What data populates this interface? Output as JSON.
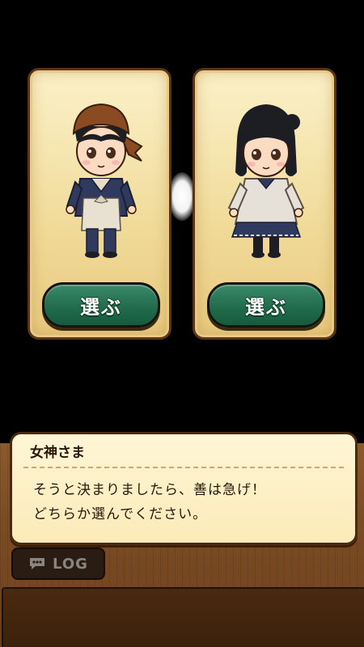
{
  "characters": [
    {
      "button_label": "選ぶ",
      "icon": "male-waiter-character"
    },
    {
      "button_label": "選ぶ",
      "icon": "female-waitress-character"
    }
  ],
  "dialog": {
    "speaker": "女神さま",
    "lines": [
      "そうと決まりましたら、善は急げ！",
      "どちらか選んでください。"
    ]
  },
  "log_button": {
    "label": "LOG",
    "icon": "chat-bubble-icon"
  },
  "colors": {
    "card_bg": "#f3e2a6",
    "card_border": "#5a3414",
    "button_green": "#1f6a4b",
    "wood": "#7a4c24",
    "dialog_bg": "#fff6d6"
  }
}
